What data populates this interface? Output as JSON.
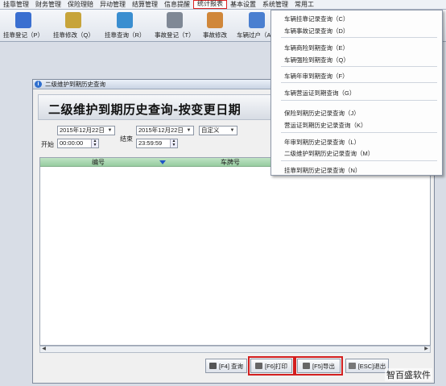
{
  "menubar": {
    "items": [
      "挂靠管理",
      "财务管理",
      "保险理赔",
      "异动管理",
      "结算管理",
      "信息提醒",
      "统计报表",
      "基本设置",
      "系统管理",
      "常用工"
    ],
    "active_index": 6
  },
  "toolbar": {
    "tools": [
      {
        "label": "挂靠登记（P）",
        "icon": "vehicle-register-icon",
        "color": "#3a6fd0"
      },
      {
        "label": "挂靠修改（Q）",
        "icon": "vehicle-edit-icon",
        "color": "#c7a43a"
      },
      {
        "label": "挂靠查询（R）",
        "icon": "vehicle-search-icon",
        "color": "#3a8ed0"
      },
      {
        "label": "事故登记（T）",
        "icon": "accident-register-icon",
        "color": "#7f8895"
      },
      {
        "label": "事故修改",
        "icon": "accident-edit-icon",
        "color": "#d0873a"
      },
      {
        "label": "车辆过户（A）",
        "icon": "vehicle-transfer-icon",
        "color": "#4a7fd0"
      }
    ]
  },
  "dropdown": {
    "groups": [
      [
        "车辆挂靠记录查询（C）",
        "车辆事故记录查询（D）"
      ],
      [
        "车辆商险到期查询（E）",
        "车辆强险到期查询（Q）"
      ],
      [
        "车辆年审到期查询（F）"
      ],
      [
        "车辆营运证到期查询（G）"
      ],
      [
        "保险到期历史记录查询（J）",
        "营运证到期历史记录查询（K）"
      ],
      [
        "年审到期历史记录查询（L）",
        "二级维护到期历史记录查询（M）"
      ],
      [
        "挂靠到期历史记录查询（N）"
      ]
    ]
  },
  "window": {
    "title": "二级维护到期历史查询",
    "heading": "二级维护到期历史查询-按变更日期",
    "filters": {
      "start_label": "开始",
      "end_label": "结束",
      "start_date": "2015年12月22日",
      "start_time": "00:00:00",
      "end_date": "2015年12月22日",
      "end_time": "23:59:59",
      "range_option": "自定义"
    },
    "grid": {
      "columns": [
        "编号",
        "车牌号"
      ]
    },
    "buttons": {
      "query": "[F4] 查询",
      "print": "[F6]打印",
      "export": "[F5]导出",
      "exit": "[ESC]退出"
    }
  },
  "watermark": "智百盛软件",
  "colors": {
    "highlight": "#d31f1f",
    "grid_header": "#a9d6b0",
    "sort_arrow": "#1e55c7"
  }
}
